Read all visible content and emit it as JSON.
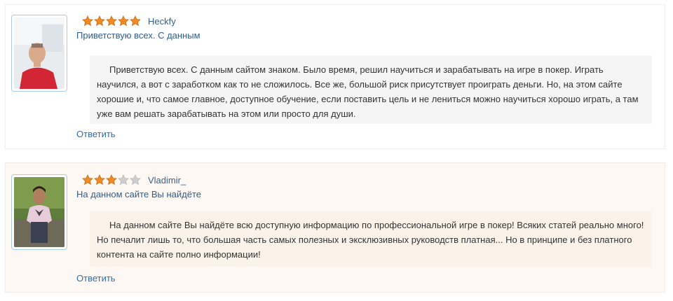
{
  "colors": {
    "star_filled": "#f08a24",
    "star_empty": "#cfcfcf",
    "link": "#2f6ea8",
    "text": "#333333"
  },
  "reviews": [
    {
      "author": "Heckfy",
      "rating": 5,
      "rating_max": 5,
      "subject": "Приветствую всех. С данным",
      "body": "Приветствую всех. С данным сайтом знаком. Было время, решил научиться и зарабатывать на игре в покер. Играть научился, а вот с заработком как то не сложилось. Все же, большой риск присутствует проиграть деньги. Но, на этом сайте хорошие и, что самое главное, доступное обучение, если поставить цель и не лениться можно научиться хорошо играть, а там уже вам решать зарабатывать на этом или просто для души.",
      "reply_label": "Ответить"
    },
    {
      "author": "Vladimir_",
      "rating": 3,
      "rating_max": 5,
      "subject": "На данном сайте Вы найдёте",
      "body": "На данном сайте Вы найдёте всю доступную информацию по профессиональной игре в покер! Всяких статей реально много! Но печалит лишь то, что большая часть самых полезных и эксклюзивных руководств платная... Но в принципе и без платного контента на сайте полно информации!",
      "reply_label": "Ответить"
    }
  ]
}
